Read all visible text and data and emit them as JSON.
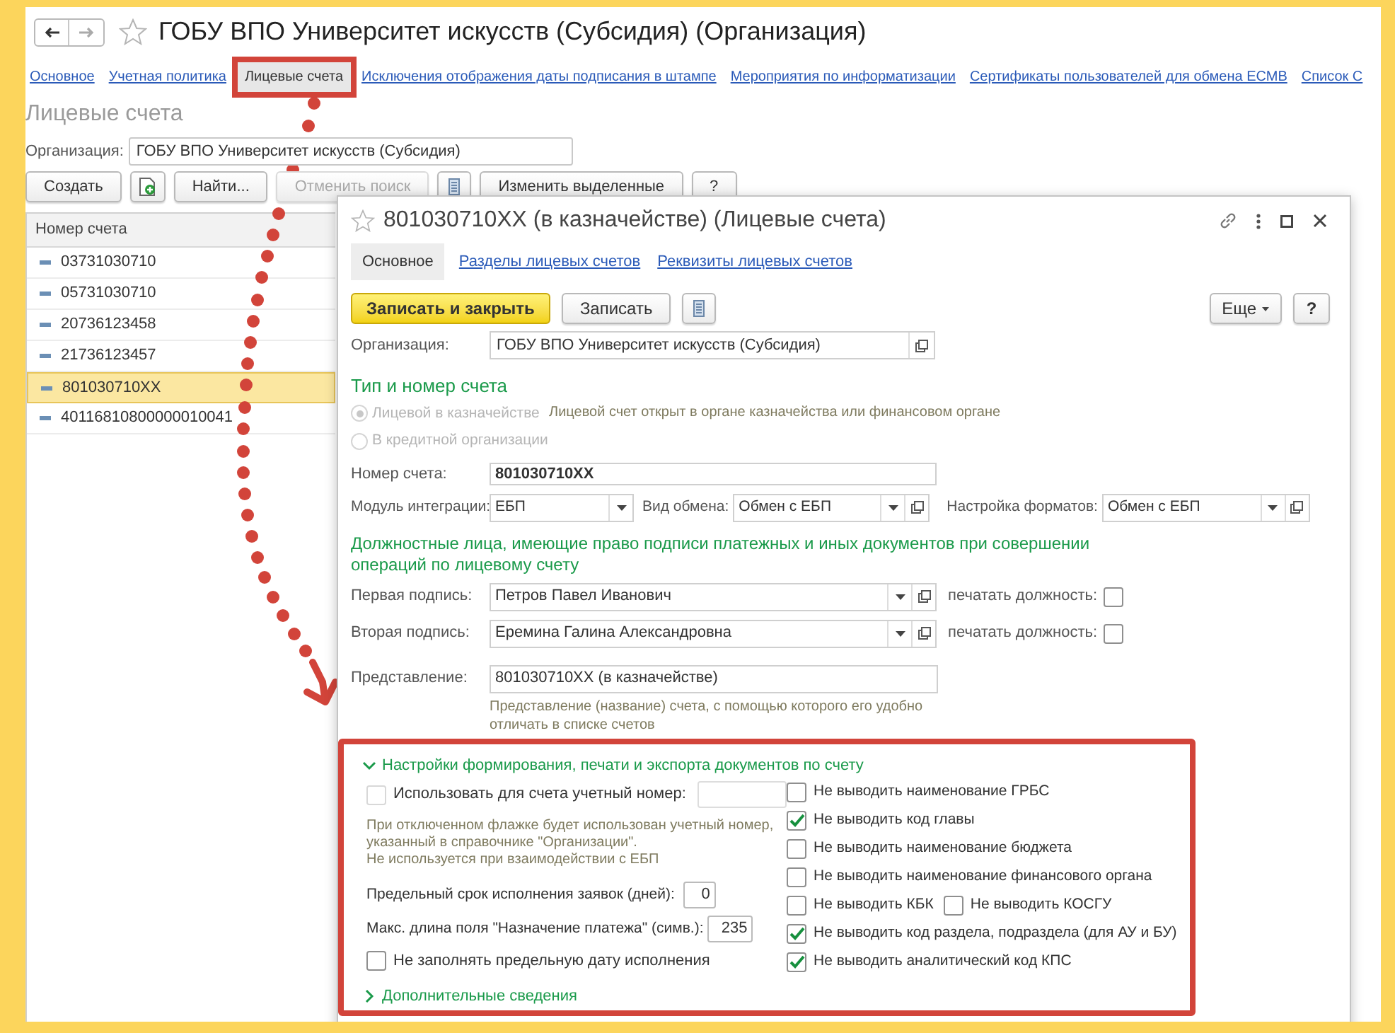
{
  "window": {
    "title": "ГОБУ ВПО Университет искусств (Субсидия) (Организация)",
    "tabs": [
      {
        "label": "Основное",
        "selected": false
      },
      {
        "label": "Учетная политика",
        "selected": false
      },
      {
        "label": "Лицевые счета",
        "selected": true
      },
      {
        "label": "Исключения отображения даты подписания в штампе",
        "selected": false
      },
      {
        "label": "Мероприятия по информатизации",
        "selected": false
      },
      {
        "label": "Сертификаты пользователей для обмена ЕСМВ",
        "selected": false
      },
      {
        "label": "Список С",
        "selected": false
      }
    ],
    "section_title": "Лицевые счета",
    "organization": {
      "label": "Организация:",
      "value": "ГОБУ ВПО Университет искусств (Субсидия)"
    },
    "toolbar": [
      {
        "kind": "text",
        "label": "Создать",
        "disabled": false
      },
      {
        "kind": "copy",
        "disabled": false
      },
      {
        "kind": "text",
        "label": "Найти...",
        "disabled": false
      },
      {
        "kind": "text",
        "label": "Отменить поиск",
        "disabled": true
      },
      {
        "kind": "list",
        "disabled": false
      },
      {
        "kind": "text",
        "label": "Изменить выделенные",
        "disabled": false
      },
      {
        "kind": "text",
        "label": "?",
        "disabled": false
      }
    ],
    "table": {
      "columns": [
        "Номер счета"
      ],
      "rows": [
        {
          "cells": [
            "03731030710"
          ],
          "selected": false
        },
        {
          "cells": [
            "05731030710"
          ],
          "selected": false
        },
        {
          "cells": [
            "20736123458"
          ],
          "selected": false
        },
        {
          "cells": [
            "21736123457"
          ],
          "selected": false
        },
        {
          "cells": [
            "801030710XX"
          ],
          "selected": true
        },
        {
          "cells": [
            "40116810800000010041"
          ],
          "selected": false
        }
      ]
    }
  },
  "dialog": {
    "title": "801030710XX (в казначействе) (Лицевые счета)",
    "tabs": [
      {
        "label": "Основное",
        "selected": true
      },
      {
        "label": "Разделы лицевых счетов",
        "selected": false
      },
      {
        "label": "Реквизиты лицевых счетов",
        "selected": false
      }
    ],
    "buttons": [
      {
        "kind": "primary",
        "label": "Записать и закрыть"
      },
      {
        "kind": "normal",
        "label": "Записать"
      },
      {
        "kind": "list"
      }
    ],
    "more_button": "Еще",
    "help_button": "?",
    "organization": {
      "label": "Организация:",
      "value": "ГОБУ ВПО Университет искусств (Субсидия)"
    },
    "type_section": {
      "title": "Тип и номер счета",
      "options": [
        {
          "label": "Лицевой в казначействе",
          "selected": true,
          "disabled": true
        },
        {
          "label": "В кредитной организации",
          "selected": false,
          "disabled": true
        }
      ],
      "note": "Лицевой счет открыт в органе казначейства или финансовом органе"
    },
    "account_number": {
      "label": "Номер счета:",
      "value": "801030710XX"
    },
    "selects": [
      {
        "label": "Модуль интеграции:",
        "value": "ЕБП",
        "open_button": false
      },
      {
        "label": "Вид обмена:",
        "value": "Обмен с ЕБП",
        "open_button": true
      },
      {
        "label": "Настройка форматов:",
        "value": "Обмен с ЕБП",
        "open_button": true
      }
    ],
    "signers_title": "Должностные лица, имеющие право подписи платежных и иных документов при совершении операций по лицевому счету",
    "signers": [
      {
        "label": "Первая подпись:",
        "value": "Петров Павел Иванович",
        "print_label": "печатать должность:",
        "checked": false
      },
      {
        "label": "Вторая подпись:",
        "value": "Еремина Галина Александровна",
        "print_label": "печатать должность:",
        "checked": false
      }
    ],
    "representation": {
      "label": "Представление:",
      "value": "801030710XX (в казначействе)",
      "hint": "Представление (название) счета, с помощью которого его удобно отличать в списке счетов"
    },
    "settings": {
      "title": "Настройки формирования, печати и экспорта документов по счету",
      "expanded": true,
      "use_number": {
        "label": "Использовать для счета учетный номер:",
        "checked": false
      },
      "note": "При отключенном флажке будет использован учетный номер,\nуказанный в справочнике \"Организации\".\nНе используется при взаимодействии с ЕБП",
      "deadline": {
        "label": "Предельный срок исполнения заявок (дней):",
        "value": "0"
      },
      "max_length": {
        "label": "Макс. длина поля \"Назначение платежа\" (симв.):",
        "value": "235"
      },
      "no_date": {
        "label": "Не заполнять предельную дату исполнения",
        "checked": false
      },
      "options": [
        [
          {
            "label": "Не выводить наименование ГРБС",
            "checked": false
          }
        ],
        [
          {
            "label": "Не выводить код главы",
            "checked": true
          }
        ],
        [
          {
            "label": "Не выводить наименование бюджета",
            "checked": false
          }
        ],
        [
          {
            "label": "Не выводить наименование финансового органа",
            "checked": false
          }
        ],
        [
          {
            "label": "Не выводить КБК",
            "checked": false
          },
          {
            "label": "Не выводить КОСГУ",
            "checked": false
          }
        ],
        [
          {
            "label": "Не выводить код раздела, подраздела (для АУ и БУ)",
            "checked": true
          }
        ],
        [
          {
            "label": "Не выводить аналитический код КПС",
            "checked": true
          }
        ]
      ]
    },
    "extra": {
      "title": "Дополнительные сведения",
      "expanded": false
    }
  }
}
